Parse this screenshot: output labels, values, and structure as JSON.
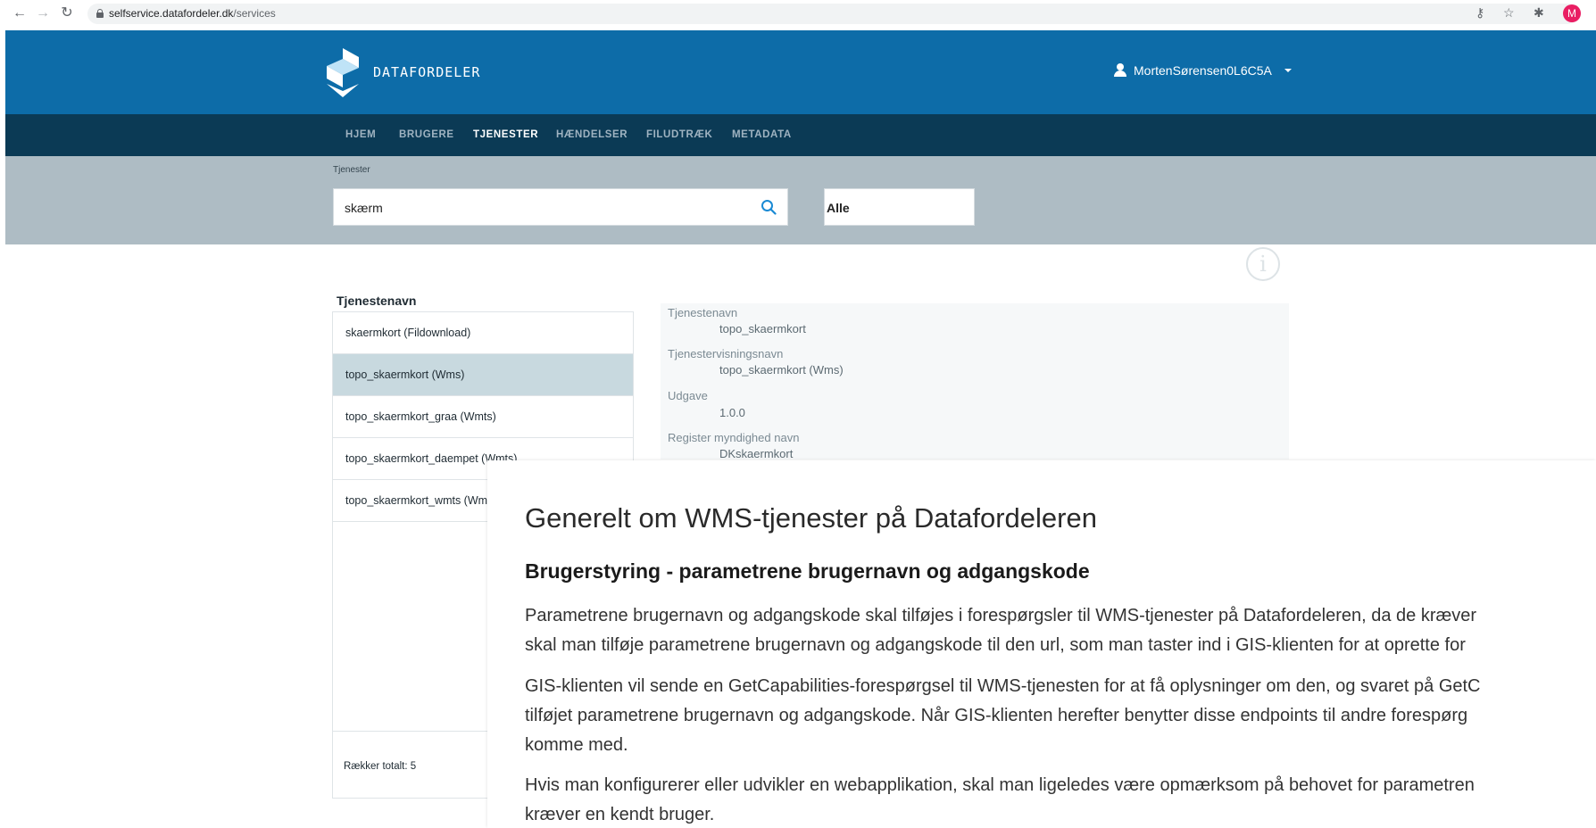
{
  "browser": {
    "url_domain": "selfservice.datafordeler.dk",
    "url_path": "/services",
    "profile_initial": "M"
  },
  "header": {
    "logo_text": "DATAFORDELER",
    "username": "MortenSørensen0L6C5A"
  },
  "nav": {
    "items": [
      "HJEM",
      "BRUGERE",
      "TJENESTER",
      "HÆNDELSER",
      "FILUDTRÆK",
      "METADATA"
    ],
    "active": "TJENESTER"
  },
  "search": {
    "breadcrumb": "Tjenester",
    "query": "skærm",
    "filter": "Alle"
  },
  "services": {
    "column_header": "Tjenestenavn",
    "items": [
      "skaermkort (Fildownload)",
      "topo_skaermkort (Wms)",
      "topo_skaermkort_graa (Wmts)",
      "topo_skaermkort_daempet (Wmts)",
      "topo_skaermkort_wmts (Wmts)"
    ],
    "selected": "topo_skaermkort (Wms)",
    "rows_total": "Rækker totalt: 5"
  },
  "details": [
    {
      "label": "Tjenestenavn",
      "value": "topo_skaermkort"
    },
    {
      "label": "Tjenestervisningsnavn",
      "value": "topo_skaermkort (Wms)"
    },
    {
      "label": "Udgave",
      "value": "1.0.0"
    },
    {
      "label": "Register myndighed navn",
      "value": "DKskaermkort"
    }
  ],
  "doc": {
    "title": "Generelt om WMS-tjenester på Datafordeleren",
    "subtitle": "Brugerstyring - parametrene brugernavn og adgangskode",
    "lines": [
      "Parametrene brugernavn og adgangskode skal tilføjes i forespørgsler til WMS-tjenester på Datafordeleren, da de kræver",
      "skal man tilføje parametrene brugernavn og adgangskode til den url, som man taster ind i GIS-klienten for at oprette for",
      "GIS-klienten vil sende en GetCapabilities-forespørgsel til WMS-tjenesten for at få oplysninger om den, og svaret på GetC",
      "tilføjet parametrene brugernavn og adgangskode. Når GIS-klienten herefter benytter disse endpoints til andre forespørg",
      "komme med.",
      "Hvis man konfigurerer eller udvikler en webapplikation, skal man ligeledes være opmærksom på behovet for parametren",
      "kræver en kendt bruger."
    ]
  },
  "colors": {
    "header_blue": "#0d6ca8",
    "nav_dark": "#0b3a55",
    "search_band": "#aebcc4",
    "selected_row": "#c8d9df",
    "accent": "#1a8ad4"
  }
}
